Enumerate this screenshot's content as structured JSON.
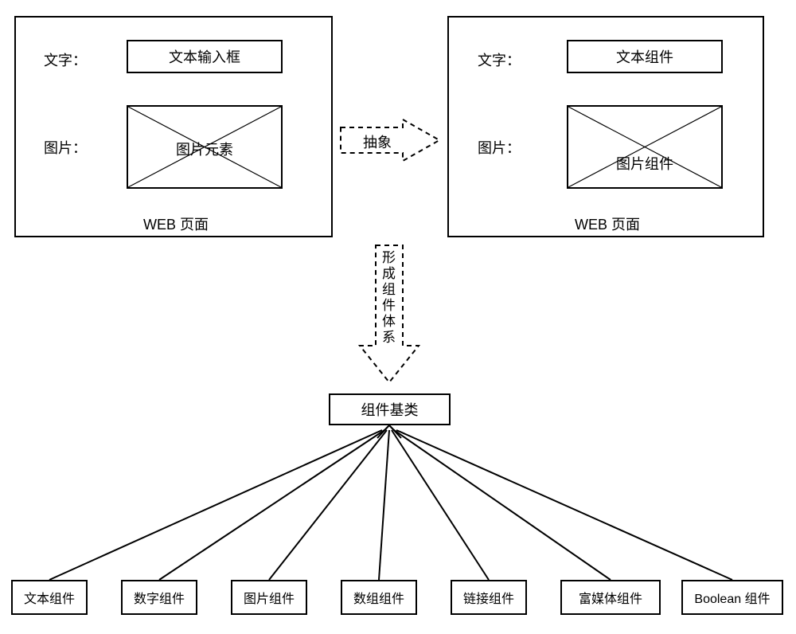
{
  "left_panel": {
    "text_label": "文字：",
    "text_box": "文本输入框",
    "image_label": "图片：",
    "image_box": "图片元素",
    "caption": "WEB 页面"
  },
  "right_panel": {
    "text_label": "文字：",
    "text_box": "文本组件",
    "image_label": "图片：",
    "image_box": "图片组件",
    "caption": "WEB 页面"
  },
  "abstract_arrow": "抽象",
  "system_arrow": "形成组件体系",
  "system_arrow_chars": {
    "c1": "形",
    "c2": "成",
    "c3": "组",
    "c4": "件",
    "c5": "体",
    "c6": "系"
  },
  "base_class": "组件基类",
  "leaves": {
    "l0": "文本组件",
    "l1": "数字组件",
    "l2": "图片组件",
    "l3": "数组组件",
    "l4": "链接组件",
    "l5": "富媒体组件",
    "l6": "Boolean 组件"
  }
}
